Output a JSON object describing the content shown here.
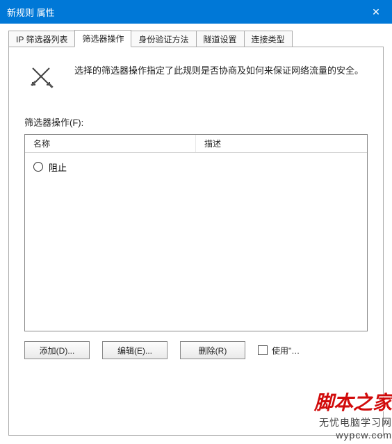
{
  "titlebar": {
    "title": "新规则 属性",
    "close_glyph": "✕"
  },
  "tabs": {
    "items": [
      {
        "label": "IP 筛选器列表",
        "active": false
      },
      {
        "label": "筛选器操作",
        "active": true
      },
      {
        "label": "身份验证方法",
        "active": false
      },
      {
        "label": "隧道设置",
        "active": false
      },
      {
        "label": "连接类型",
        "active": false
      }
    ]
  },
  "info": {
    "text": "选择的筛选器操作指定了此规则是否协商及如何来保证网络流量的安全。"
  },
  "section": {
    "label": "筛选器操作(F):"
  },
  "listview": {
    "columns": {
      "name": "名称",
      "desc": "描述"
    },
    "rows": [
      {
        "name": "阻止",
        "desc": ""
      }
    ]
  },
  "buttons": {
    "add": "添加(D)...",
    "edit": "编辑(E)...",
    "remove": "删除(R)"
  },
  "checkbox": {
    "label": "使用\"…"
  },
  "watermark": {
    "line1": "脚本之家",
    "line2": "无忧电脑学习网",
    "line3": "wypcw.com"
  }
}
